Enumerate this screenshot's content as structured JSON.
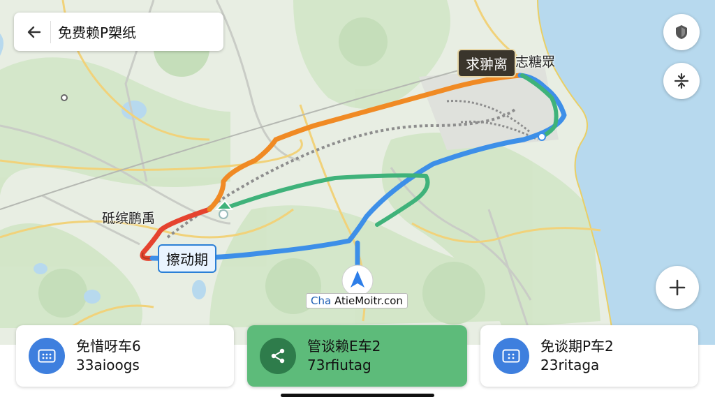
{
  "search": {
    "title": "免费赖P槊纸"
  },
  "map": {
    "labels": {
      "top_right": "志糖眾",
      "left": "砥缤鹏禹"
    },
    "pills": {
      "dark": "求翀离",
      "blue": "擦动期"
    },
    "location_box": {
      "prefix": "Cha",
      "text": "AtieMoitr.con"
    }
  },
  "buttons": {
    "shield": "shield-icon",
    "recenter": "compress-arrows-icon",
    "zoom_in": "+"
  },
  "cards": [
    {
      "line1": "免惜呀车6",
      "line2": "33aioogs",
      "icon": "parking-icon",
      "active": false
    },
    {
      "line1": "管谈赖E车2",
      "line2": "73rfiutag",
      "icon": "share-icon",
      "active": true
    },
    {
      "line1": "免谈期P车2",
      "line2": "23ritaga",
      "icon": "parking-icon",
      "active": false
    }
  ],
  "colors": {
    "orange_route": "#f08a24",
    "red_route": "#e5432f",
    "blue_route": "#3d8fe8",
    "green_route": "#3fb27a",
    "water": "#b7d9ee",
    "active_card": "#5dbb7a"
  }
}
